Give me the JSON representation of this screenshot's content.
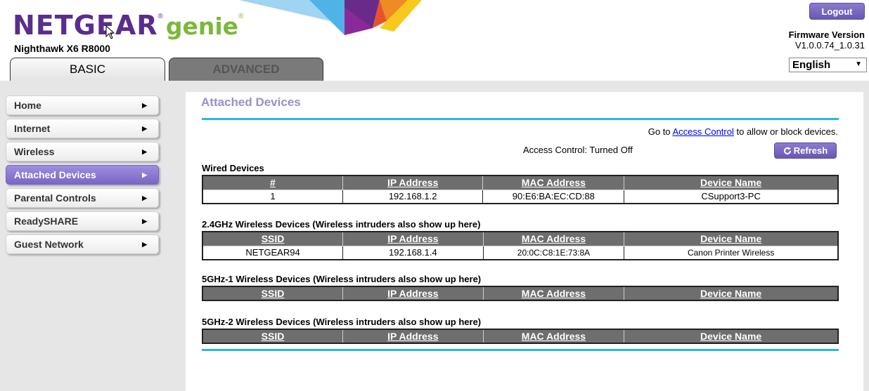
{
  "header": {
    "logo": {
      "netgear": "NETGEAR",
      "genie": "genie",
      "reg_mark": "®"
    },
    "model": "Nighthawk X6 R8000",
    "logout_label": "Logout",
    "firmware_label": "Firmware Version",
    "firmware_value": "V1.0.0.74_1.0.31",
    "language": "English"
  },
  "tabs": [
    {
      "label": "BASIC",
      "active": true
    },
    {
      "label": "ADVANCED",
      "active": false
    }
  ],
  "sidebar": {
    "items": [
      {
        "label": "Home"
      },
      {
        "label": "Internet"
      },
      {
        "label": "Wireless"
      },
      {
        "label": "Attached Devices",
        "active": true
      },
      {
        "label": "Parental Controls"
      },
      {
        "label": "ReadySHARE"
      },
      {
        "label": "Guest Network"
      }
    ]
  },
  "main": {
    "title": "Attached Devices",
    "goto_prefix": "Go to",
    "goto_link": "Access Control",
    "goto_suffix": "to allow or block devices.",
    "access_control_status": "Access Control: Turned Off",
    "refresh_label": "Refresh",
    "wired": {
      "title": "Wired Devices",
      "headers": [
        "#",
        "IP Address",
        "MAC Address",
        "Device Name"
      ],
      "rows": [
        [
          "1",
          "192.168.1.2",
          "90:E6:BA:EC:CD:88",
          "CSupport3-PC"
        ]
      ]
    },
    "wireless_24": {
      "title": "2.4GHz Wireless Devices (Wireless intruders also show up here)",
      "headers": [
        "SSID",
        "IP Address",
        "MAC Address",
        "Device Name"
      ],
      "rows": [
        [
          "NETGEAR94",
          "192.168.1.4",
          "20:0C:C8:1E:73:8A",
          "Canon Printer Wireless"
        ]
      ]
    },
    "wireless_5g1": {
      "title": "5GHz-1 Wireless Devices (Wireless intruders also show up here)",
      "headers": [
        "SSID",
        "IP Address",
        "MAC Address",
        "Device Name"
      ],
      "rows": []
    },
    "wireless_5g2": {
      "title": "5GHz-2 Wireless Devices (Wireless intruders also show up here)",
      "headers": [
        "SSID",
        "IP Address",
        "MAC Address",
        "Device Name"
      ],
      "rows": []
    }
  },
  "colors": {
    "brand_purple": "#5a2d8c",
    "genie_green": "#7cb83a",
    "accent_blue": "#29b7e6",
    "button_purple": "#7a66c4",
    "header_gray": "#6e6e6e"
  }
}
